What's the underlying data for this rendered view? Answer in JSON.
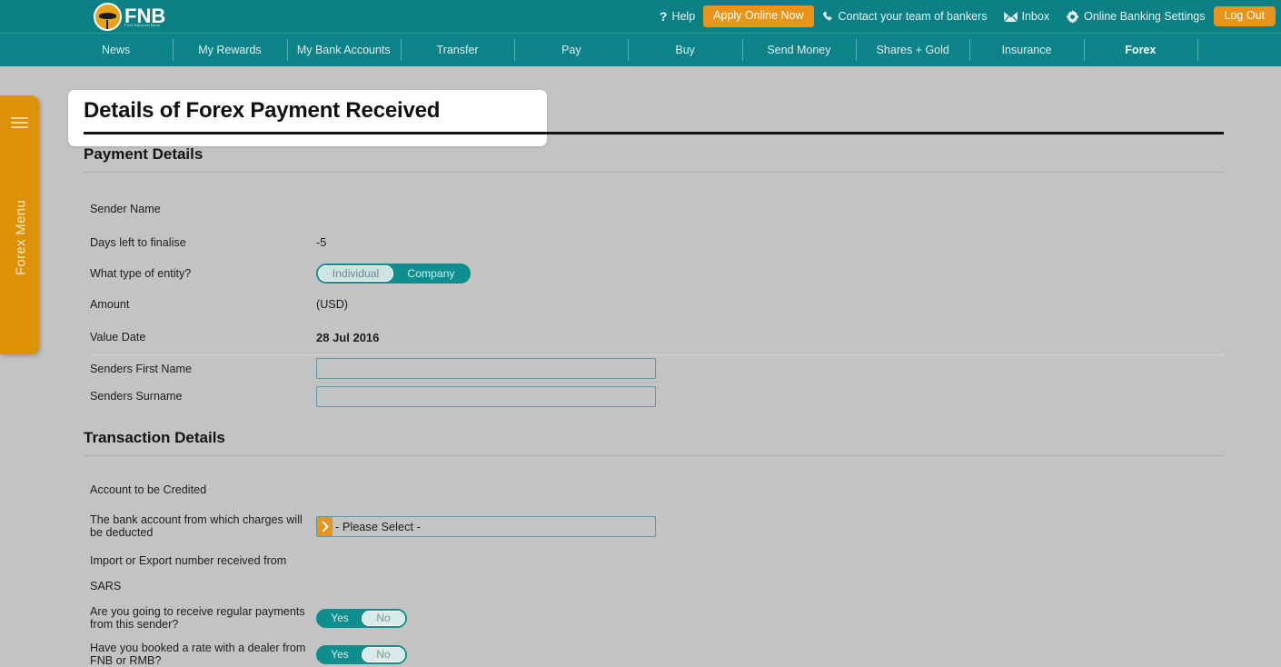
{
  "brand": {
    "name": "FNB",
    "tagline": "First National Bank",
    "teal": "#0b8186",
    "orange": "#e8941a",
    "page_bg": "#c3c3c3"
  },
  "topbar": {
    "help": "Help",
    "apply_button": "Apply Online Now",
    "contact": "Contact your team of bankers",
    "inbox": "Inbox",
    "settings": "Online Banking Settings",
    "logout": "Log Out"
  },
  "nav": {
    "items": [
      {
        "label": "News",
        "active": false
      },
      {
        "label": "My Rewards",
        "active": false
      },
      {
        "label": "My Bank Accounts",
        "active": false
      },
      {
        "label": "Transfer",
        "active": false
      },
      {
        "label": "Pay",
        "active": false
      },
      {
        "label": "Buy",
        "active": false
      },
      {
        "label": "Send Money",
        "active": false
      },
      {
        "label": "Shares + Gold",
        "active": false
      },
      {
        "label": "Insurance",
        "active": false
      },
      {
        "label": "Forex",
        "active": true
      }
    ]
  },
  "sidebar": {
    "label": "Forex Menu"
  },
  "page": {
    "title": "Details of Forex Payment Received"
  },
  "payment_details": {
    "heading": "Payment Details",
    "sender_name_label": "Sender Name",
    "sender_name_value": "",
    "days_left_label": "Days left to finalise",
    "days_left_value": "-5",
    "entity_type_label": "What type of entity?",
    "entity_type_options": [
      "Individual",
      "Company"
    ],
    "entity_type_selected": "Individual",
    "amount_label": "Amount",
    "amount_value": "(USD)",
    "value_date_label": "Value Date",
    "value_date_value": "28 Jul 2016",
    "first_name_label": "Senders First Name",
    "first_name_value": "",
    "first_name_placeholder": "",
    "surname_label": "Senders Surname",
    "surname_value": "",
    "surname_placeholder": ""
  },
  "transaction_details": {
    "heading": "Transaction Details",
    "account_credited_label": "Account to be Credited",
    "account_credited_value": "",
    "charges_account_label": "The bank account from which charges will be deducted",
    "charges_account_selected": "- Please Select -",
    "sars_label": "Import or Export number received from",
    "sars_label2": "SARS",
    "sars_value": "",
    "regular_payments_label": "Are you going to receive regular payments from this sender?",
    "regular_payments_options": [
      "Yes",
      "No"
    ],
    "regular_payments_selected": "No",
    "booked_rate_label": "Have you booked a rate with a dealer from FNB or RMB?",
    "booked_rate_options": [
      "Yes",
      "No"
    ],
    "booked_rate_selected": "No"
  }
}
